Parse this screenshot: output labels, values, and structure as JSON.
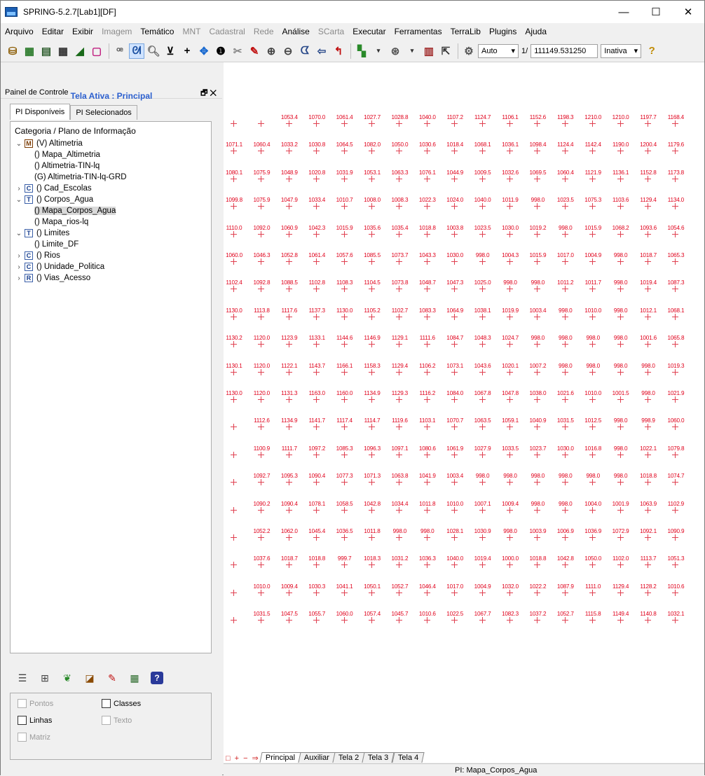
{
  "window": {
    "title": "SPRING-5.2.7[Lab1][DF]",
    "minimize": "—",
    "maximize": "☐",
    "close": "✕"
  },
  "menu": [
    {
      "label": "Arquivo",
      "enabled": true
    },
    {
      "label": "Editar",
      "enabled": true
    },
    {
      "label": "Exibir",
      "enabled": true
    },
    {
      "label": "Imagem",
      "enabled": false
    },
    {
      "label": "Temático",
      "enabled": true
    },
    {
      "label": "MNT",
      "enabled": false
    },
    {
      "label": "Cadastral",
      "enabled": false
    },
    {
      "label": "Rede",
      "enabled": false
    },
    {
      "label": "Análise",
      "enabled": true
    },
    {
      "label": "SCarta",
      "enabled": false
    },
    {
      "label": "Executar",
      "enabled": true
    },
    {
      "label": "Ferramentas",
      "enabled": true
    },
    {
      "label": "TerraLib",
      "enabled": true
    },
    {
      "label": "Plugins",
      "enabled": true
    },
    {
      "label": "Ajuda",
      "enabled": true
    }
  ],
  "toolbar": {
    "icons": [
      "database-icon",
      "image-icon",
      "table-icon",
      "grid-icon",
      "line-icon",
      "square-icon",
      "selection-icon",
      "view-icon",
      "zoom-icon",
      "scroll-icon",
      "plus-icon",
      "pan-icon",
      "info-icon",
      "cut-icon",
      "draw-icon",
      "zoom-in-icon",
      "zoom-out-icon",
      "zoom-back-icon",
      "arrow-icon",
      "undo-icon",
      "palette-icon",
      "dropdown-icon",
      "grid-cursor-icon",
      "chart-icon",
      "pointer-icon",
      "settings-icon"
    ],
    "scale_mode": "Auto",
    "scale_prefix": "1/",
    "scale_value": "111149.531250",
    "state": "Inativa"
  },
  "panel": {
    "title": "Painel de Controle",
    "float_btn": "🗗",
    "close_btn": "✕",
    "active_screen": "Tela Ativa : Principal",
    "tabs": [
      "PI Disponíveis",
      "PI Selecionados"
    ],
    "tree_header": "Categoria / Plano de Informação",
    "tree": [
      {
        "toggle": "⌄",
        "badge": "M",
        "label": "(V) Altimetria",
        "indent": 0
      },
      {
        "toggle": "",
        "badge": "",
        "label": "() Mapa_Altimetria",
        "indent": 1
      },
      {
        "toggle": "",
        "badge": "",
        "label": "() Altimetria-TIN-lq",
        "indent": 1
      },
      {
        "toggle": "",
        "badge": "",
        "label": "(G) Altimetria-TIN-lq-GRD",
        "indent": 1
      },
      {
        "toggle": "›",
        "badge": "C",
        "label": "() Cad_Escolas",
        "indent": 0
      },
      {
        "toggle": "⌄",
        "badge": "T",
        "label": "() Corpos_Agua",
        "indent": 0
      },
      {
        "toggle": "",
        "badge": "",
        "label": "() Mapa_Corpos_Agua",
        "indent": 1,
        "selected": true
      },
      {
        "toggle": "",
        "badge": "",
        "label": "() Mapa_rios-lq",
        "indent": 1
      },
      {
        "toggle": "⌄",
        "badge": "T",
        "label": "() Limites",
        "indent": 0
      },
      {
        "toggle": "",
        "badge": "",
        "label": "() Limite_DF",
        "indent": 1
      },
      {
        "toggle": "›",
        "badge": "C",
        "label": "() Rios",
        "indent": 0
      },
      {
        "toggle": "›",
        "badge": "C",
        "label": "() Unidade_Politica",
        "indent": 0
      },
      {
        "toggle": "›",
        "badge": "R",
        "label": "() Vias_Acesso",
        "indent": 0
      }
    ],
    "bottom_icons": [
      "list-icon",
      "tool-icon",
      "leaf-icon",
      "chart-icon",
      "pencil-icon",
      "table-icon",
      "help-icon"
    ],
    "checks": [
      {
        "label": "Pontos",
        "enabled": false
      },
      {
        "label": "Classes",
        "enabled": true
      },
      {
        "label": "Linhas",
        "enabled": true
      },
      {
        "label": "Texto",
        "enabled": false
      },
      {
        "label": "Matriz",
        "enabled": false
      }
    ]
  },
  "grid_values": [
    [
      "",
      "",
      "1053.4",
      "1070.0",
      "1061.4",
      "1027.7",
      "1028.8",
      "1040.0",
      "1107.2",
      "1124.7",
      "1106.1",
      "1152.6",
      "1198.3",
      "1210.0",
      "1210.0",
      "1197.7",
      "1168.4"
    ],
    [
      "1071.1",
      "1060.4",
      "1033.2",
      "1030.8",
      "1064.5",
      "1082.0",
      "1050.0",
      "1030.6",
      "1018.4",
      "1068.1",
      "1036.1",
      "1098.4",
      "1124.4",
      "1142.4",
      "1190.0",
      "1200.4",
      "1179.6"
    ],
    [
      "1080.1",
      "1075.9",
      "1048.9",
      "1020.8",
      "1031.9",
      "1053.1",
      "1063.3",
      "1076.1",
      "1044.9",
      "1009.5",
      "1032.6",
      "1069.5",
      "1060.4",
      "1121.9",
      "1136.1",
      "1152.8",
      "1173.8"
    ],
    [
      "1099.8",
      "1075.9",
      "1047.9",
      "1033.4",
      "1010.7",
      "1008.0",
      "1008.3",
      "1022.3",
      "1024.0",
      "1040.0",
      "1011.9",
      "998.0",
      "1023.5",
      "1075.3",
      "1103.6",
      "1129.4",
      "1134.0"
    ],
    [
      "1110.0",
      "1092.0",
      "1060.9",
      "1042.3",
      "1015.9",
      "1035.6",
      "1035.4",
      "1018.8",
      "1003.8",
      "1023.5",
      "1030.0",
      "1019.2",
      "998.0",
      "1015.9",
      "1068.2",
      "1093.6",
      "1054.6"
    ],
    [
      "1060.0",
      "1046.3",
      "1052.8",
      "1061.4",
      "1057.6",
      "1085.5",
      "1073.7",
      "1043.3",
      "1030.0",
      "998.0",
      "1004.3",
      "1015.9",
      "1017.0",
      "1004.9",
      "998.0",
      "1018.7",
      "1065.3"
    ],
    [
      "1102.4",
      "1092.8",
      "1088.5",
      "1102.8",
      "1108.3",
      "1104.5",
      "1073.8",
      "1048.7",
      "1047.3",
      "1025.0",
      "998.0",
      "998.0",
      "1011.2",
      "1011.7",
      "998.0",
      "1019.4",
      "1087.3"
    ],
    [
      "1130.0",
      "1113.8",
      "1117.6",
      "1137.3",
      "1130.0",
      "1105.2",
      "1102.7",
      "1083.3",
      "1064.9",
      "1038.1",
      "1019.9",
      "1003.4",
      "998.0",
      "1010.0",
      "998.0",
      "1012.1",
      "1068.1"
    ],
    [
      "1130.2",
      "1120.0",
      "1123.9",
      "1133.1",
      "1144.6",
      "1146.9",
      "1129.1",
      "1111.6",
      "1084.7",
      "1048.3",
      "1024.7",
      "998.0",
      "998.0",
      "998.0",
      "998.0",
      "1001.6",
      "1065.8"
    ],
    [
      "1130.1",
      "1120.0",
      "1122.1",
      "1143.7",
      "1166.1",
      "1158.3",
      "1129.4",
      "1106.2",
      "1073.1",
      "1043.6",
      "1020.1",
      "1007.2",
      "998.0",
      "998.0",
      "998.0",
      "998.0",
      "1019.3"
    ],
    [
      "1130.0",
      "1120.0",
      "1131.3",
      "1163.0",
      "1160.0",
      "1134.9",
      "1129.3",
      "1116.2",
      "1084.0",
      "1067.8",
      "1047.8",
      "1038.0",
      "1021.6",
      "1010.0",
      "1001.5",
      "998.0",
      "1021.9"
    ],
    [
      "",
      "1112.6",
      "1134.9",
      "1141.7",
      "1117.4",
      "1114.7",
      "1119.6",
      "1103.1",
      "1070.7",
      "1063.5",
      "1059.1",
      "1040.9",
      "1031.5",
      "1012.5",
      "998.0",
      "998.9",
      "1060.0"
    ],
    [
      "",
      "1100.9",
      "1111.7",
      "1097.2",
      "1085.3",
      "1096.3",
      "1097.1",
      "1080.6",
      "1061.9",
      "1027.9",
      "1033.5",
      "1023.7",
      "1030.0",
      "1016.8",
      "998.0",
      "1022.1",
      "1079.8"
    ],
    [
      "",
      "1092.7",
      "1095.3",
      "1090.4",
      "1077.3",
      "1071.3",
      "1063.8",
      "1041.9",
      "1003.4",
      "998.0",
      "998.0",
      "998.0",
      "998.0",
      "998.0",
      "998.0",
      "1018.8",
      "1074.7"
    ],
    [
      "",
      "1090.2",
      "1090.4",
      "1078.1",
      "1058.5",
      "1042.8",
      "1034.4",
      "1011.8",
      "1010.0",
      "1007.1",
      "1009.4",
      "998.0",
      "998.0",
      "1004.0",
      "1001.9",
      "1063.9",
      "1102.9"
    ],
    [
      "",
      "1052.2",
      "1062.0",
      "1045.4",
      "1036.5",
      "1011.8",
      "998.0",
      "998.0",
      "1028.1",
      "1030.9",
      "998.0",
      "1003.9",
      "1006.9",
      "1036.9",
      "1072.9",
      "1092.1",
      "1090.9"
    ],
    [
      "",
      "1037.6",
      "1018.7",
      "1018.8",
      "999.7",
      "1018.3",
      "1031.2",
      "1036.3",
      "1040.0",
      "1019.4",
      "1000.0",
      "1018.8",
      "1042.8",
      "1050.0",
      "1102.0",
      "1113.7",
      "1051.3"
    ],
    [
      "",
      "1010.0",
      "1009.4",
      "1030.3",
      "1041.1",
      "1050.1",
      "1052.7",
      "1046.4",
      "1017.0",
      "1004.9",
      "1032.0",
      "1022.2",
      "1087.9",
      "1111.0",
      "1129.4",
      "1128.2",
      "1010.6"
    ],
    [
      "",
      "1031.5",
      "1047.5",
      "1055.7",
      "1060.0",
      "1057.4",
      "1045.7",
      "1010.6",
      "1022.5",
      "1067.7",
      "1082.3",
      "1037.2",
      "1052.7",
      "1115.8",
      "1149.4",
      "1140.8",
      "1032.1"
    ]
  ],
  "bottom_tabs": {
    "nav": [
      "□",
      "+",
      "−",
      "⇒"
    ],
    "tabs": [
      "Principal",
      "Auxiliar",
      "Tela 2",
      "Tela 3",
      "Tela 4"
    ],
    "active": "Principal"
  },
  "status": "PI: Mapa_Corpos_Agua"
}
